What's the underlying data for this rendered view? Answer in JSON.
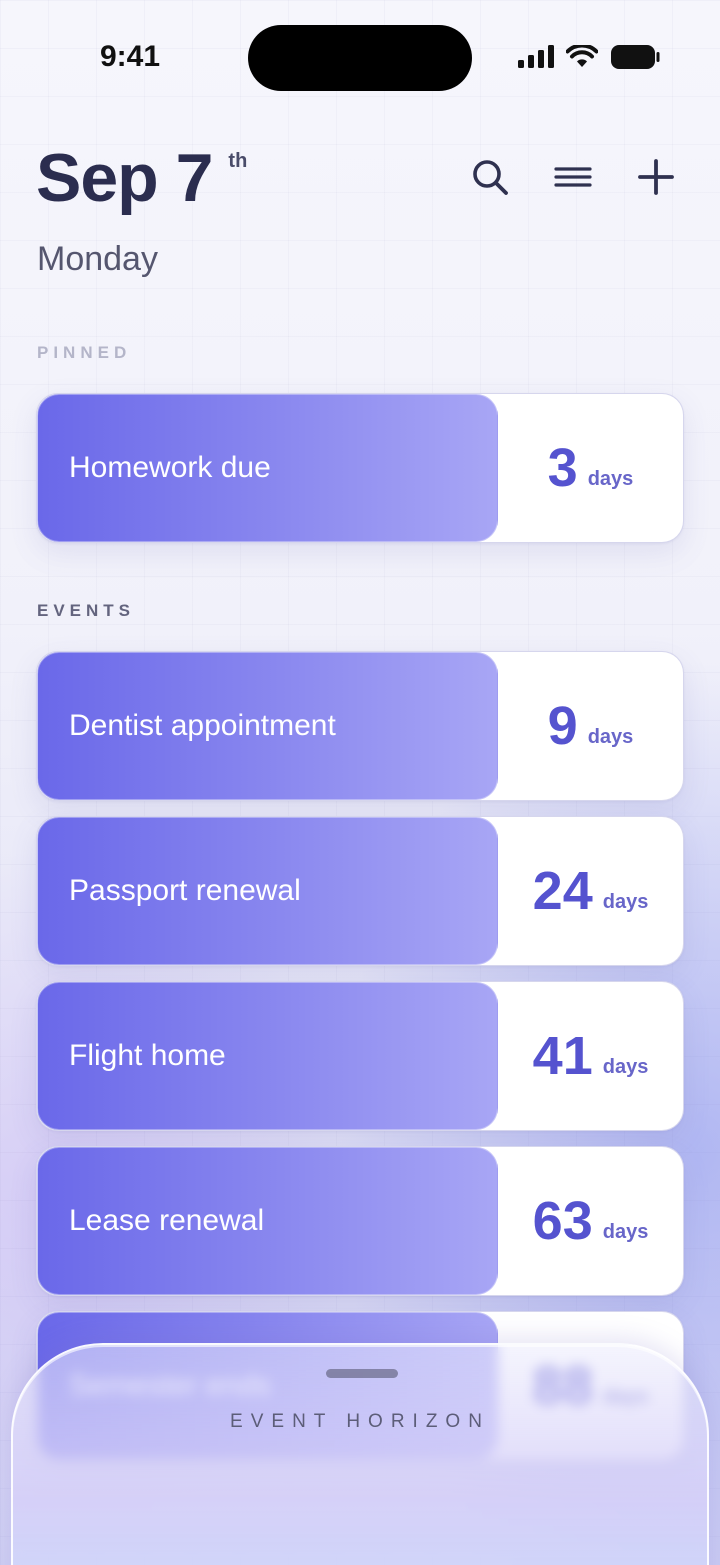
{
  "status_bar": {
    "time": "9:41"
  },
  "header": {
    "date": "Sep 7",
    "date_suffix": "th",
    "weekday": "Monday",
    "actions": {
      "search": "search-icon",
      "menu": "menu-icon",
      "add": "plus-icon"
    }
  },
  "pinned": {
    "label": "PINNED",
    "items": [
      {
        "title": "Homework due",
        "count": "3",
        "unit": "days"
      }
    ]
  },
  "events": {
    "label": "EVENTS",
    "items": [
      {
        "title": "Dentist appointment",
        "count": "9",
        "unit": "days"
      },
      {
        "title": "Passport renewal",
        "count": "24",
        "unit": "days"
      },
      {
        "title": "Flight home",
        "count": "41",
        "unit": "days"
      },
      {
        "title": "Lease renewal",
        "count": "63",
        "unit": "days"
      },
      {
        "title": "Semester ends",
        "count": "88",
        "unit": "days"
      }
    ]
  },
  "sheet": {
    "title": "EVENT HORIZON"
  },
  "colors": {
    "accent": "#5553cf",
    "card_fill_start": "#6a68e9",
    "card_fill_end": "#a8a6f5",
    "text_dark": "#2b2d4f"
  }
}
